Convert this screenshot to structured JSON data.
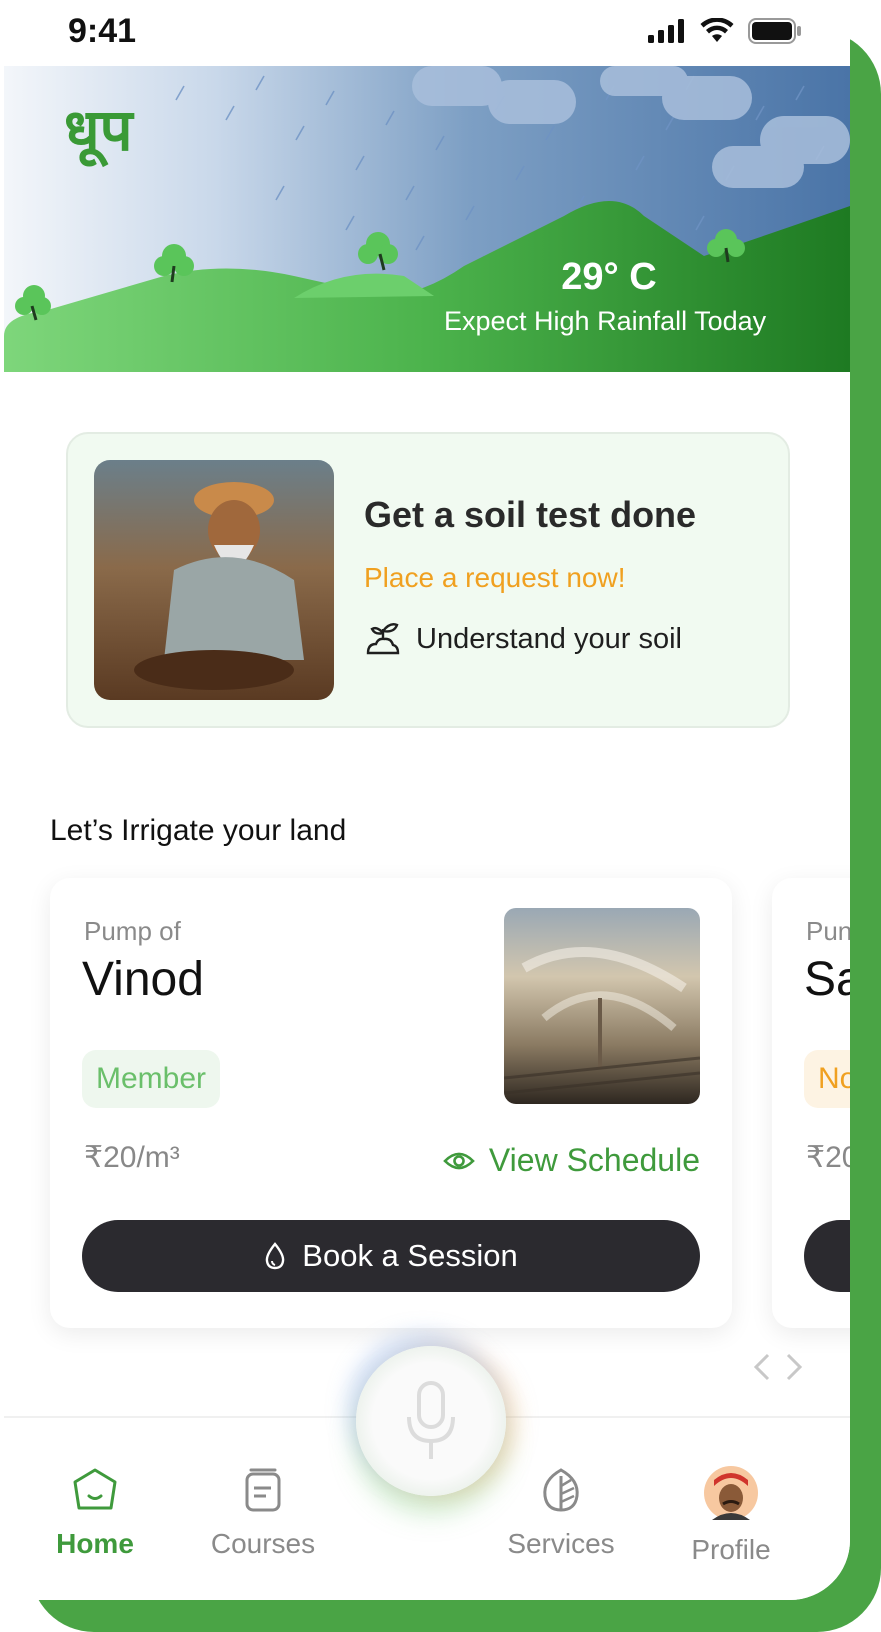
{
  "status_bar": {
    "time": "9:41"
  },
  "hero": {
    "logo": "धूप",
    "temperature": "29° C",
    "forecast": "Expect High Rainfall Today"
  },
  "soil_card": {
    "title": "Get a soil test done",
    "cta": "Place a request now!",
    "link_label": "Understand your soil",
    "image": "farmer-in-soil-photo"
  },
  "irrigation": {
    "section_title": "Let’s Irrigate your land",
    "cards": [
      {
        "pump_of_label": "Pump of",
        "owner": "Vinod",
        "badge": "Member",
        "price": "₹20/m³",
        "view_schedule_label": "View Schedule",
        "book_label": "Book a Session",
        "image": "sprinkler-field-photo"
      },
      {
        "pump_of_label": "Pun",
        "owner": "Sa",
        "badge": "No",
        "price": "₹20"
      }
    ]
  },
  "bottom_nav": {
    "items": [
      {
        "label": "Home",
        "icon": "home-icon",
        "active": true
      },
      {
        "label": "Courses",
        "icon": "courses-icon",
        "active": false
      },
      {
        "label": "Services",
        "icon": "services-icon",
        "active": false
      },
      {
        "label": "Profile",
        "icon": "profile-avatar",
        "active": false
      }
    ],
    "mic_icon": "microphone-icon"
  },
  "colors": {
    "brand_green": "#3f9a3c",
    "accent_orange": "#f0a020",
    "button_dark": "#2b2a2f"
  }
}
